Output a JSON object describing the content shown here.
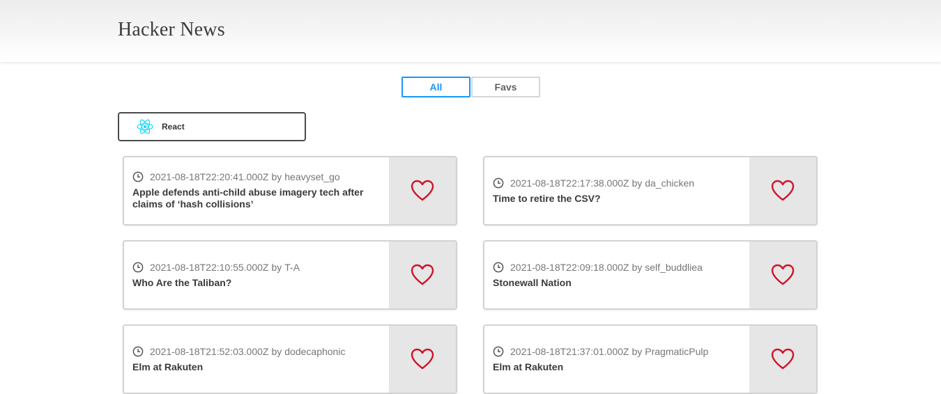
{
  "header": {
    "title": "Hacker News"
  },
  "tabs": [
    {
      "label": "All",
      "active": true
    },
    {
      "label": "Favs",
      "active": false
    }
  ],
  "framework_select": {
    "selected": "React",
    "icon": "react-icon"
  },
  "colors": {
    "accent": "#1797ff",
    "heart": "#d0122b",
    "react": "#00d8ff"
  },
  "stories": [
    {
      "time": "2021-08-18T22:20:41.000Z",
      "by": "by",
      "author": "heavyset_go",
      "title": "Apple defends anti-child abuse imagery tech after claims of ‘hash collisions’",
      "fav": false
    },
    {
      "time": "2021-08-18T22:17:38.000Z",
      "by": "by",
      "author": "da_chicken",
      "title": "Time to retire the CSV?",
      "fav": false
    },
    {
      "time": "2021-08-18T22:10:55.000Z",
      "by": "by",
      "author": "T-A",
      "title": "Who Are the Taliban?",
      "fav": false
    },
    {
      "time": "2021-08-18T22:09:18.000Z",
      "by": "by",
      "author": "self_buddliea",
      "title": "Stonewall Nation",
      "fav": false
    },
    {
      "time": "2021-08-18T21:52:03.000Z",
      "by": "by",
      "author": "dodecaphonic",
      "title": "Elm at Rakuten",
      "fav": false
    },
    {
      "time": "2021-08-18T21:37:01.000Z",
      "by": "by",
      "author": "PragmaticPulp",
      "title": "Elm at Rakuten",
      "fav": false
    }
  ]
}
